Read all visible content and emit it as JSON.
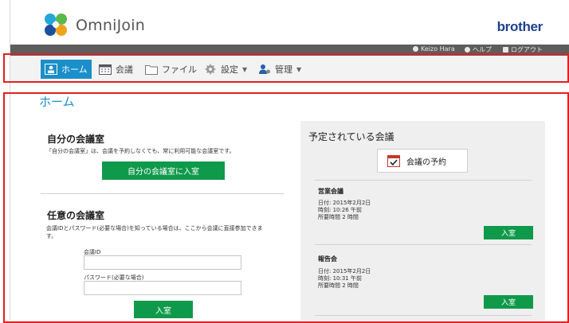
{
  "header": {
    "app_name": "OmniJoin",
    "brand": "brother"
  },
  "userbar": {
    "user": "Keizo Hara",
    "help": "ヘルプ",
    "logout": "ログアウト"
  },
  "nav": {
    "items": [
      {
        "label": "ホーム",
        "icon": "home-icon"
      },
      {
        "label": "会議",
        "icon": "calendar-icon"
      },
      {
        "label": "ファイル",
        "icon": "folder-icon"
      },
      {
        "label": "設定",
        "icon": "gear-icon"
      },
      {
        "label": "管理",
        "icon": "admin-icon"
      }
    ],
    "active": "ホーム",
    "accent": "#1a8fc9"
  },
  "page": {
    "title": "ホーム"
  },
  "my_room": {
    "title": "自分の会議室",
    "description": "「自分の会議室」は、会議を予約しなくても、常に利用可能な会議室です。",
    "button": "自分の会議室に入室"
  },
  "any_room": {
    "title": "任意の会議室",
    "description_line1": "会議IDとパスワード(必要な場合)を知っている場合は、ここから会議に直接参加できま",
    "description_line2": "す。",
    "meeting_id_label": "会議ID",
    "meeting_id_value": "",
    "password_label": "パスワード(必要な場合)",
    "password_value": "",
    "button": "入室"
  },
  "scheduled": {
    "title": "予定されている会議",
    "reserve_button": "会議の予約",
    "meetings": [
      {
        "name": "営業会議",
        "date": "日付: 2015年2月2日",
        "time": "時刻: 10:26 午前",
        "duration": "所要時間 2 時間",
        "button": "入室"
      },
      {
        "name": "報告会",
        "date": "日付: 2015年2月2日",
        "time": "時刻: 10:31 午前",
        "duration": "所要時間 2 時間",
        "button": "入室"
      }
    ]
  },
  "colors": {
    "green": "#0f9a4b",
    "accent": "#1a8fc9",
    "brand": "#1d3f8f",
    "highlight": "#e02020"
  }
}
